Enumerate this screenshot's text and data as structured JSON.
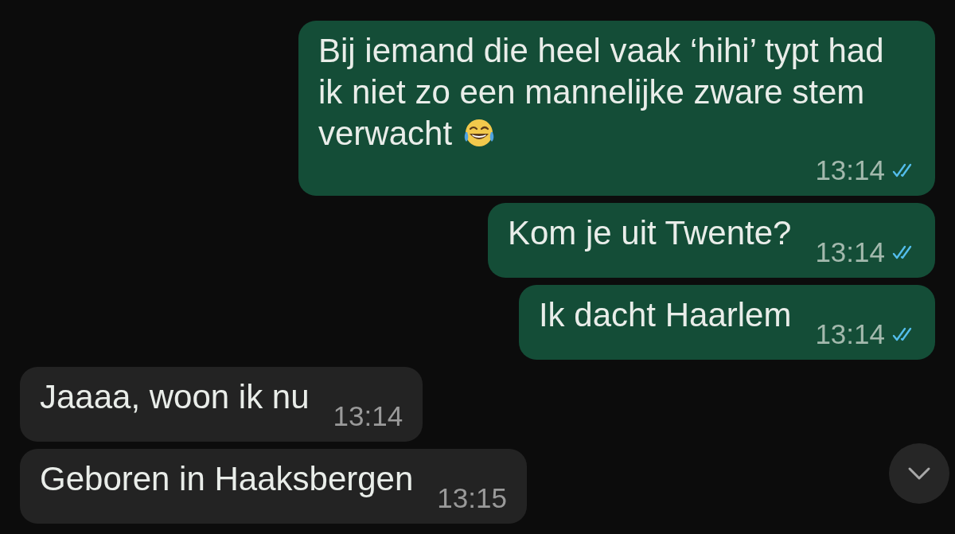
{
  "messages": [
    {
      "kind": "outgoing",
      "text": "Bij iemand die heel vaak ‘hihi’ typt had ik niet zo een mannelijke zware stem verwacht",
      "emoji": true,
      "time": "13:14",
      "read": true
    },
    {
      "kind": "outgoing",
      "text": "Kom je uit Twente?",
      "emoji": false,
      "time": "13:14",
      "read": true
    },
    {
      "kind": "outgoing",
      "text": "Ik dacht Haarlem",
      "emoji": false,
      "time": "13:14",
      "read": true
    },
    {
      "kind": "incoming",
      "text": "Jaaaa, woon ik nu",
      "time": "13:14"
    },
    {
      "kind": "incoming",
      "text": "Geboren in Haaksbergen",
      "time": "13:15"
    }
  ]
}
